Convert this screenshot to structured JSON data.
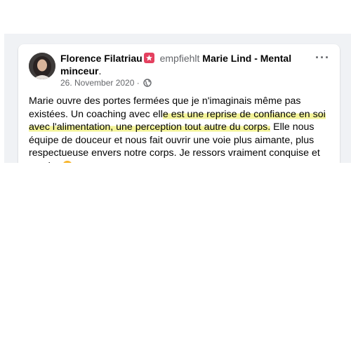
{
  "post": {
    "author": "Florence Filatriau",
    "action": "empfiehlt",
    "page": "Marie Lind - Mental minceur",
    "page_suffix": ".",
    "date": "26. November 2020",
    "date_sep": "·",
    "more_label": "···",
    "body": {
      "part1": "Marie ouvre des portes fermées que je n'imaginais même pas existées. Un coaching avec ell",
      "highlight": "e est une reprise de confiance en soi avec l'alimentation, une perception tout autre du corps.",
      "part2": " Elle nous équipe de douceur et nous fait ouvrir une voie plus aimante, plus respectueuse envers notre corps. Je ressors vraiment conquise et sereine"
    },
    "colors": {
      "highlight": "#f0f078",
      "recommend_badge": "#e4405f",
      "like": "#1877f2",
      "love": "#f33e58"
    },
    "icons": [
      "recommend-icon",
      "globe-icon",
      "heart-eyes-emoji-icon",
      "like-reaction-icon",
      "love-reaction-icon"
    ]
  }
}
